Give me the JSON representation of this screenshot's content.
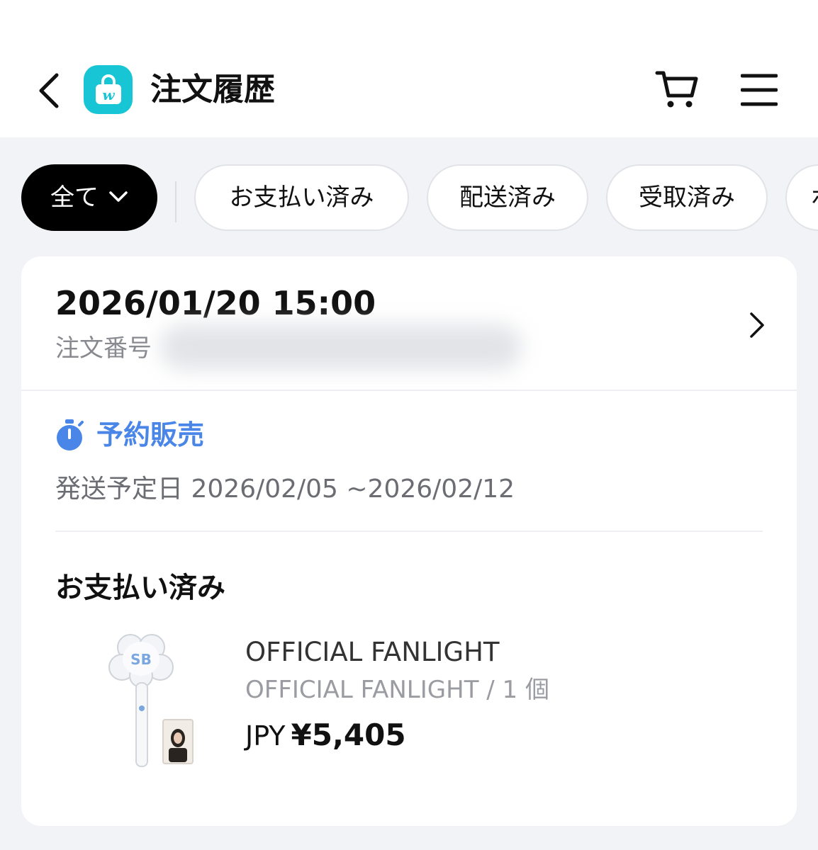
{
  "header": {
    "title": "注文履歴",
    "back_icon": "chevron-left-icon",
    "logo_letter": "w",
    "logo_color": "#18c5d4",
    "cart_icon": "cart-icon",
    "menu_icon": "hamburger-menu-icon"
  },
  "filters": {
    "items": [
      {
        "label": "全て",
        "active": true
      },
      {
        "label": "お支払い済み",
        "active": false
      },
      {
        "label": "配送済み",
        "active": false
      },
      {
        "label": "受取済み",
        "active": false
      },
      {
        "label": "ボ",
        "active": false
      }
    ]
  },
  "order": {
    "datetime": "2026/01/20 15:00",
    "number_label": "注文番号",
    "sale_type": "予約販売",
    "sale_type_color": "#4a86e8",
    "ship_date": "発送予定日 2026/02/05 ~2026/02/12",
    "status": "お支払い済み",
    "product": {
      "name": "OFFICIAL FANLIGHT",
      "option": "OFFICIAL FANLIGHT / 1 個",
      "currency": "JPY",
      "price": "¥5,405"
    }
  }
}
